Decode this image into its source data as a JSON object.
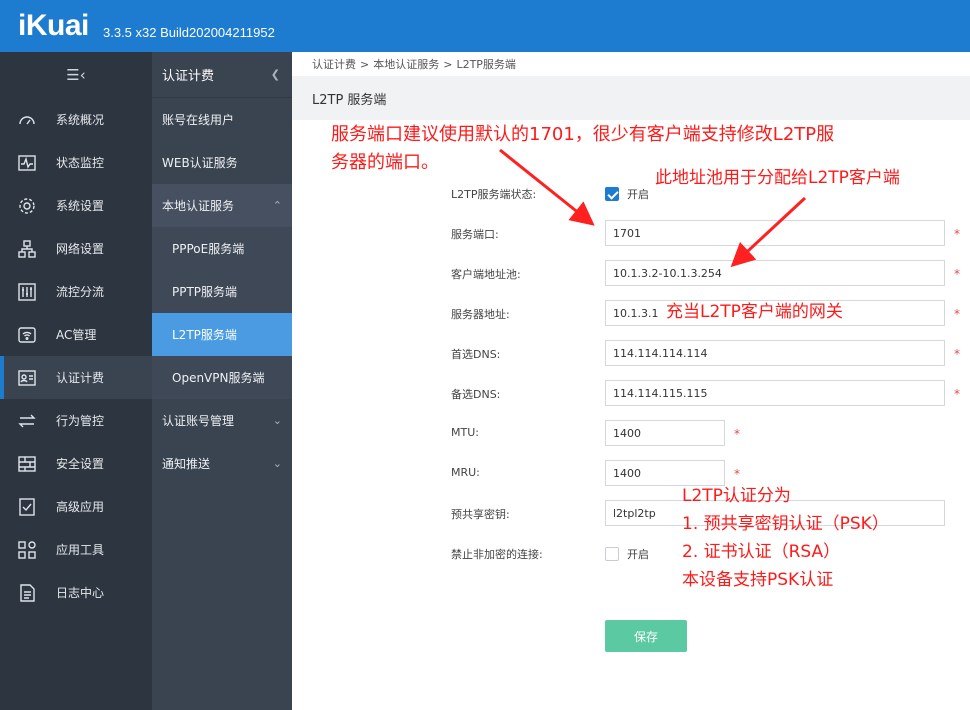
{
  "header": {
    "logo": "iKuai",
    "version": "3.3.5 x32 Build202004211952"
  },
  "nav": {
    "menu_icon": "☰‹",
    "items": [
      {
        "label": "系统概况",
        "icon": "gauge-icon"
      },
      {
        "label": "状态监控",
        "icon": "pulse-icon"
      },
      {
        "label": "系统设置",
        "icon": "gear-icon"
      },
      {
        "label": "网络设置",
        "icon": "network-icon"
      },
      {
        "label": "流控分流",
        "icon": "sliders-icon"
      },
      {
        "label": "AC管理",
        "icon": "wifi-icon"
      },
      {
        "label": "认证计费",
        "icon": "id-card-icon"
      },
      {
        "label": "行为管控",
        "icon": "arrows-icon"
      },
      {
        "label": "安全设置",
        "icon": "firewall-icon"
      },
      {
        "label": "高级应用",
        "icon": "check-doc-icon"
      },
      {
        "label": "应用工具",
        "icon": "apps-icon"
      },
      {
        "label": "日志中心",
        "icon": "doc-icon"
      }
    ]
  },
  "subnav": {
    "title": "认证计费",
    "items": [
      {
        "label": "账号在线用户"
      },
      {
        "label": "WEB认证服务"
      },
      {
        "label": "本地认证服务"
      },
      {
        "label": "PPPoE服务端"
      },
      {
        "label": "PPTP服务端"
      },
      {
        "label": "L2TP服务端"
      },
      {
        "label": "OpenVPN服务端"
      },
      {
        "label": "认证账号管理"
      },
      {
        "label": "通知推送"
      }
    ]
  },
  "breadcrumb": [
    "认证计费",
    ">",
    "本地认证服务",
    ">",
    "L2TP服务端"
  ],
  "page_title": "L2TP 服务端",
  "form": {
    "status": {
      "label": "L2TP服务端状态:",
      "checkbox_label": "开启",
      "checked": true
    },
    "port": {
      "label": "服务端口:",
      "value": "1701"
    },
    "pool": {
      "label": "客户端地址池:",
      "value": "10.1.3.2-10.1.3.254"
    },
    "server_addr": {
      "label": "服务器地址:",
      "value": "10.1.3.1"
    },
    "dns1": {
      "label": "首选DNS:",
      "value": "114.114.114.114"
    },
    "dns2": {
      "label": "备选DNS:",
      "value": "114.114.115.115"
    },
    "mtu": {
      "label": "MTU:",
      "value": "1400"
    },
    "mru": {
      "label": "MRU:",
      "value": "1400"
    },
    "psk": {
      "label": "预共享密钥:",
      "value": "l2tpl2tp"
    },
    "no_encrypt": {
      "label": "禁止非加密的连接:",
      "checkbox_label": "开启",
      "checked": false
    },
    "required_mark": "*",
    "save_label": "保存"
  },
  "annotations": {
    "port_note_1": "服务端口建议使用默认的1701，很少有客户端支持修改L2TP服",
    "port_note_2": "务器的端口。",
    "pool_note": "此地址池用于分配给L2TP客户端",
    "gateway_note": "充当L2TP客户端的网关",
    "auth_1": "L2TP认证分为",
    "auth_2": "1. 预共享密钥认证（PSK）",
    "auth_3": "2. 证书认证（RSA）",
    "auth_4": "本设备支持PSK认证",
    "color": "#ff1a1a"
  }
}
